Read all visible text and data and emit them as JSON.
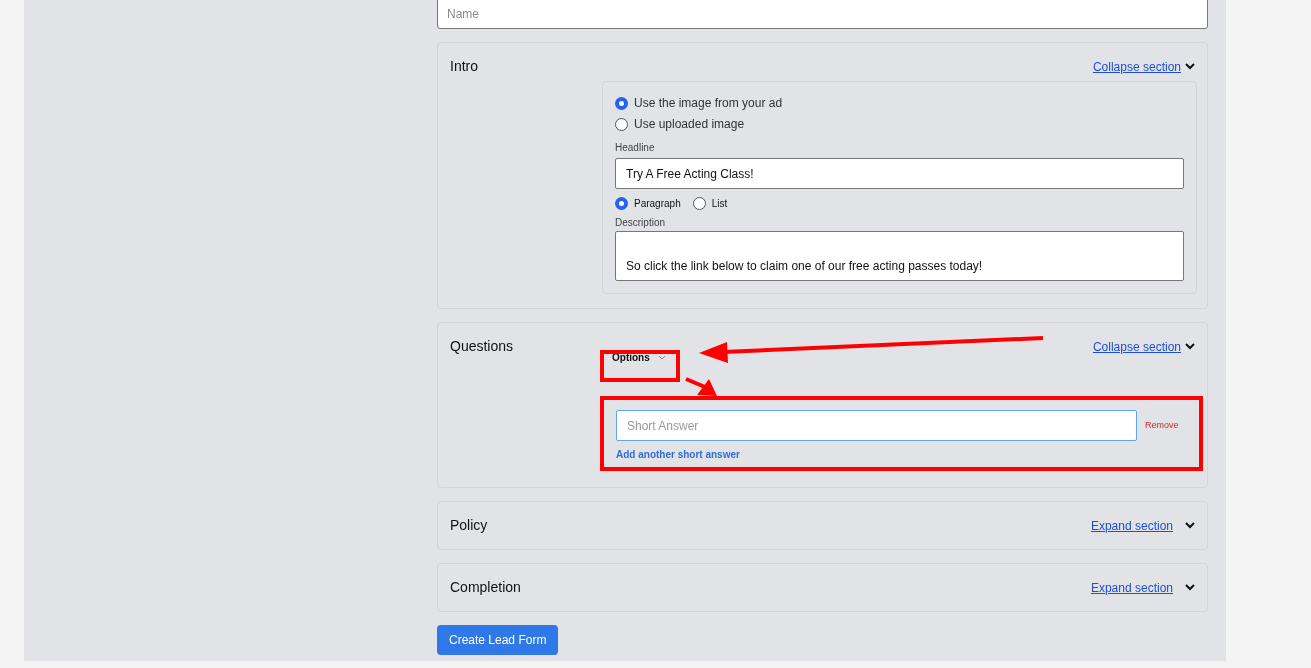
{
  "name_field": {
    "placeholder": "Name"
  },
  "sections": [
    {
      "kind": "intro",
      "title": "Intro",
      "toggle": "Collapse section",
      "expanded": true,
      "image_options": [
        {
          "label": "Use the image from your ad",
          "selected": true
        },
        {
          "label": "Use uploaded image",
          "selected": false
        }
      ],
      "headline_label": "Headline",
      "headline": "Try A Free Acting Class!",
      "format_options": [
        {
          "label": "Paragraph",
          "selected": true
        },
        {
          "label": "List",
          "selected": false
        }
      ],
      "description_label": "Description",
      "description": "So click the link below to claim one of our free acting passes today!"
    },
    {
      "kind": "questions",
      "title": "Questions",
      "toggle": "Collapse section",
      "expanded": true,
      "options_button": "Options",
      "answer_placeholder": "Short Answer",
      "remove": "Remove",
      "add_another": "Add another short answer"
    },
    {
      "title": "Policy",
      "toggle": "Expand section",
      "expanded": false
    },
    {
      "title": "Completion",
      "toggle": "Expand section",
      "expanded": false
    }
  ],
  "submit": "Create Lead Form"
}
